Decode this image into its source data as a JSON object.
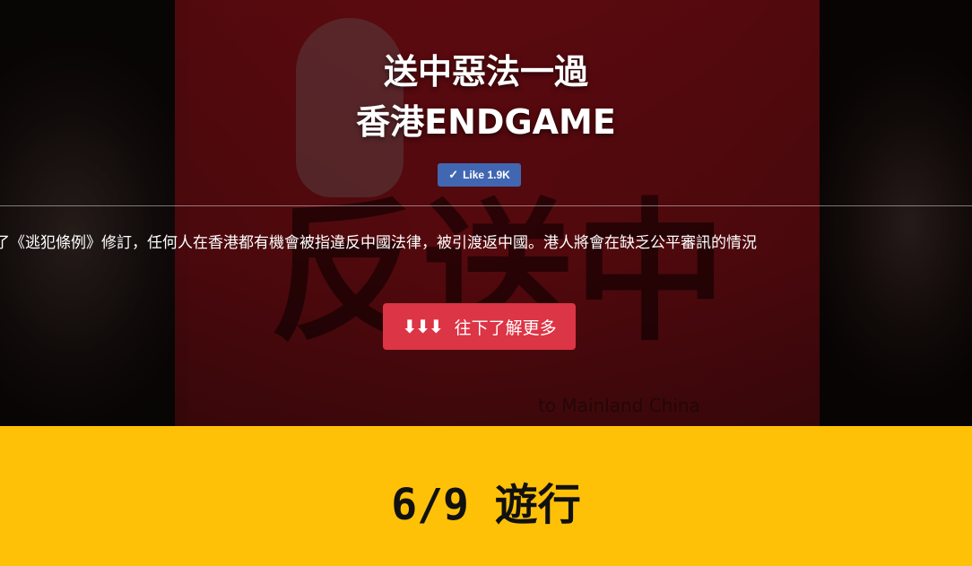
{
  "hero": {
    "title_line1": "送中惡法一過",
    "title_line2": "香港ENDGAME",
    "like_label": "Like 1.9K",
    "intro_text": "了《逃犯條例》修訂，任何人在香港都有機會被指違反中國法律，被引渡返中國。港人將會在缺乏公平審訊的情況",
    "cta_label": "往下了解更多",
    "background_sign_text": "反送中",
    "background_caption": "to Mainland China"
  },
  "section": {
    "title": "6/9 遊行"
  },
  "colors": {
    "like_button": "#4267b2",
    "cta_button": "#dc3545",
    "section_bg": "#ffc107"
  }
}
